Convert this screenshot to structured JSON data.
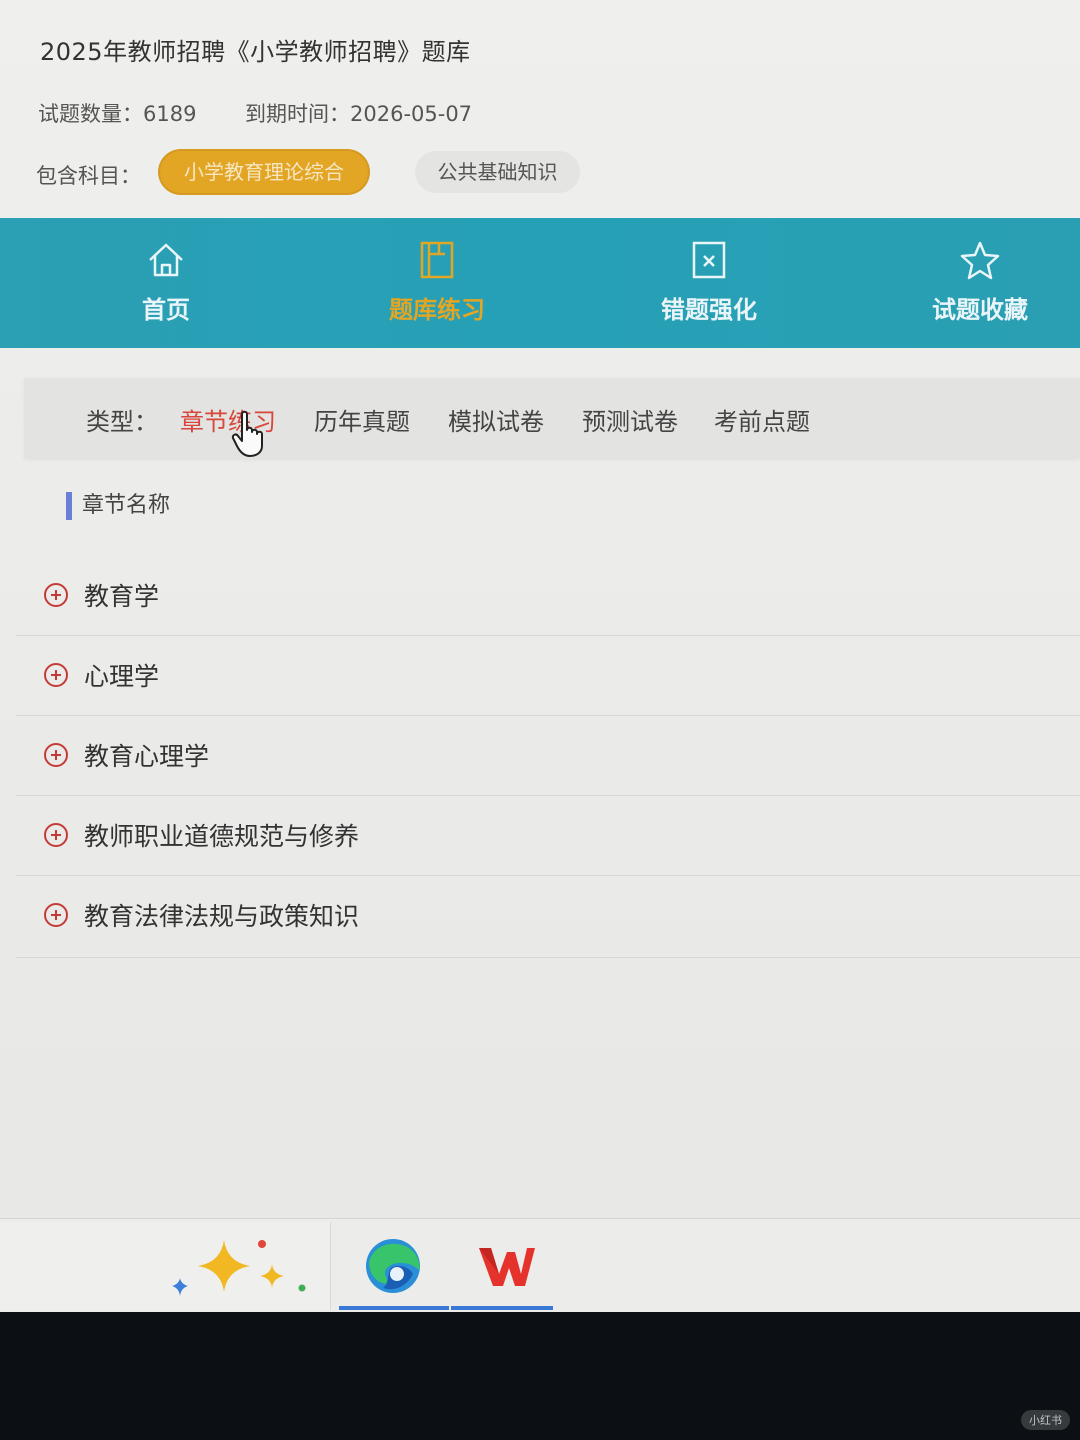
{
  "header": {
    "title": "2025年教师招聘《小学教师招聘》题库",
    "count_label": "试题数量：",
    "count_value": "6189",
    "expire_label": "到期时间：",
    "expire_value": "2026-05-07",
    "subjects_label": "包含科目：",
    "subjects": [
      "小学教育理论综合",
      "公共基础知识"
    ],
    "active_subject_color": "#e2a524"
  },
  "nav": {
    "bar_color": "#26a0b6",
    "items": [
      {
        "label": "首页",
        "icon": "home-icon"
      },
      {
        "label": "题库练习",
        "icon": "book-icon",
        "active": true
      },
      {
        "label": "错题强化",
        "icon": "wrong-answer-icon"
      },
      {
        "label": "试题收藏",
        "icon": "star-icon"
      }
    ]
  },
  "types": {
    "label": "类型：",
    "tabs": [
      "章节练习",
      "历年真题",
      "模拟试卷",
      "预测试卷",
      "考前点题"
    ],
    "active_color": "#d9463b"
  },
  "chapters": {
    "header": "章节名称",
    "items": [
      "教育学",
      "心理学",
      "教育心理学",
      "教师职业道德规范与修养",
      "教育法律法规与政策知识"
    ]
  },
  "taskbar": {
    "apps": [
      "sparkle-app-icon",
      "edge-browser-icon",
      "wps-office-icon"
    ]
  },
  "watermark": "小红书"
}
